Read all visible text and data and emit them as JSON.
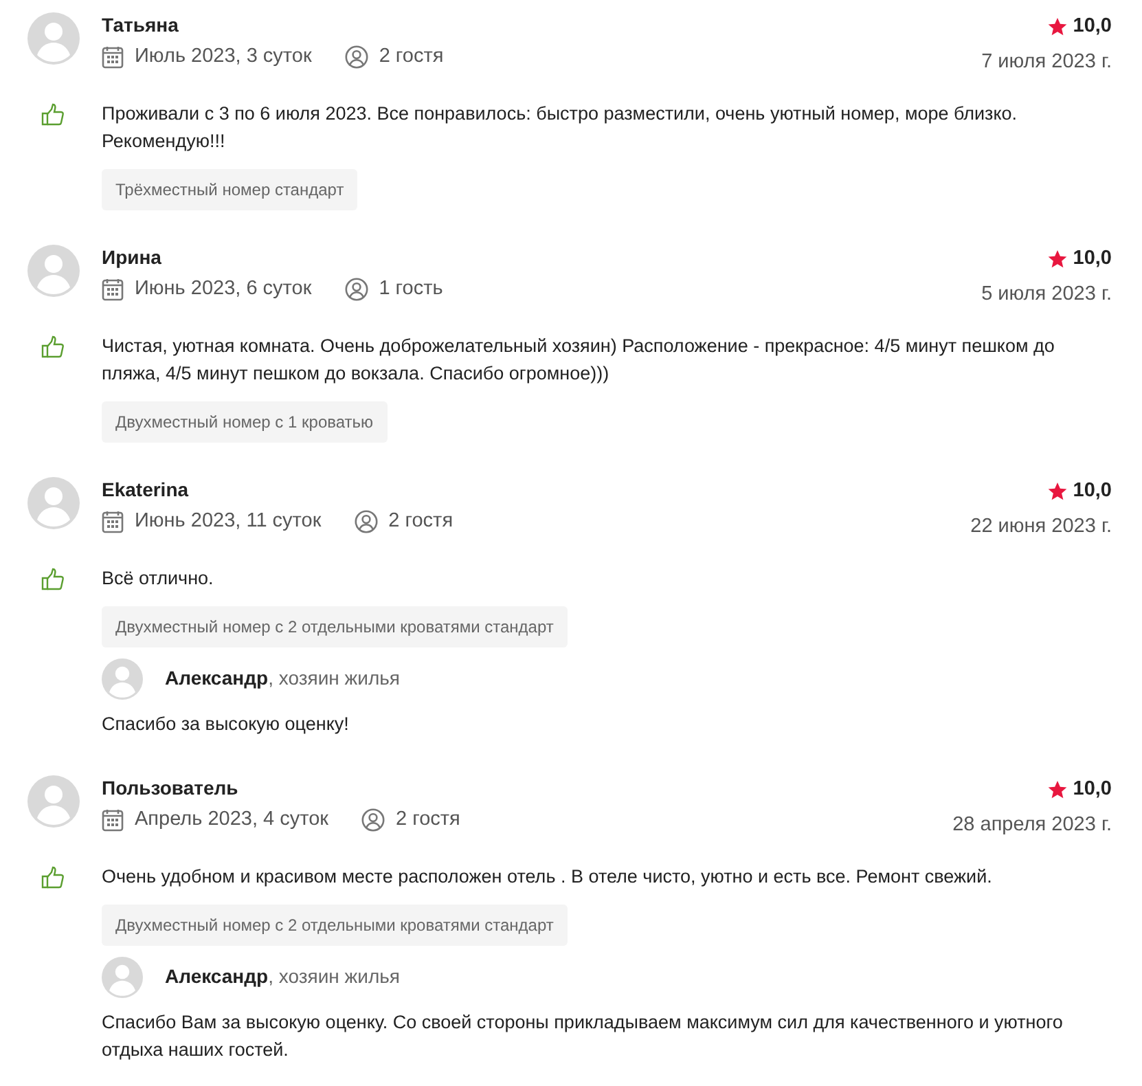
{
  "reviews": [
    {
      "author": "Татьяна",
      "stay": "Июль 2023, 3 суток",
      "guests": "2 гостя",
      "rating": "10,0",
      "date": "7 июля 2023 г.",
      "text": "Проживали с 3 по 6 июля 2023. Все понравилось: быстро разместили, очень уютный номер, море близко. Рекомендую!!!",
      "room": "Трёхместный номер стандарт"
    },
    {
      "author": "Ирина",
      "stay": "Июнь 2023, 6 суток",
      "guests": "1 гость",
      "rating": "10,0",
      "date": "5 июля 2023 г.",
      "text": "Чистая, уютная комната. Очень доброжелательный хозяин) Расположение - прекрасное: 4/5 минут пешком до пляжа, 4/5 минут пешком до вокзала. Спасибо огромное)))",
      "room": "Двухместный номер с 1 кроватью"
    },
    {
      "author": "Ekaterina",
      "stay": "Июнь 2023, 11 суток",
      "guests": "2 гостя",
      "rating": "10,0",
      "date": "22 июня 2023 г.",
      "text": "Всё отлично.",
      "room": "Двухместный номер с 2 отдельными кроватями стандарт",
      "reply": {
        "host": "**Александр**, хозяин жилья",
        "text": "Спасибо за высокую оценку!"
      }
    },
    {
      "author": "Пользователь",
      "stay": "Апрель 2023, 4 суток",
      "guests": "2 гостя",
      "rating": "10,0",
      "date": "28 апреля 2023 г.",
      "text": "Очень удобном и красивом месте расположен отель . В отеле чисто, уютно и есть все. Ремонт свежий.",
      "room": "Двухместный номер с 2 отдельными кроватями стандарт",
      "reply": {
        "host": "**Александр**, хозяин жилья",
        "text": "Спасибо Вам за высокую оценку. Со своей стороны прикладываем максимум сил для качественного и уютного отдыха наших гостей."
      }
    }
  ]
}
